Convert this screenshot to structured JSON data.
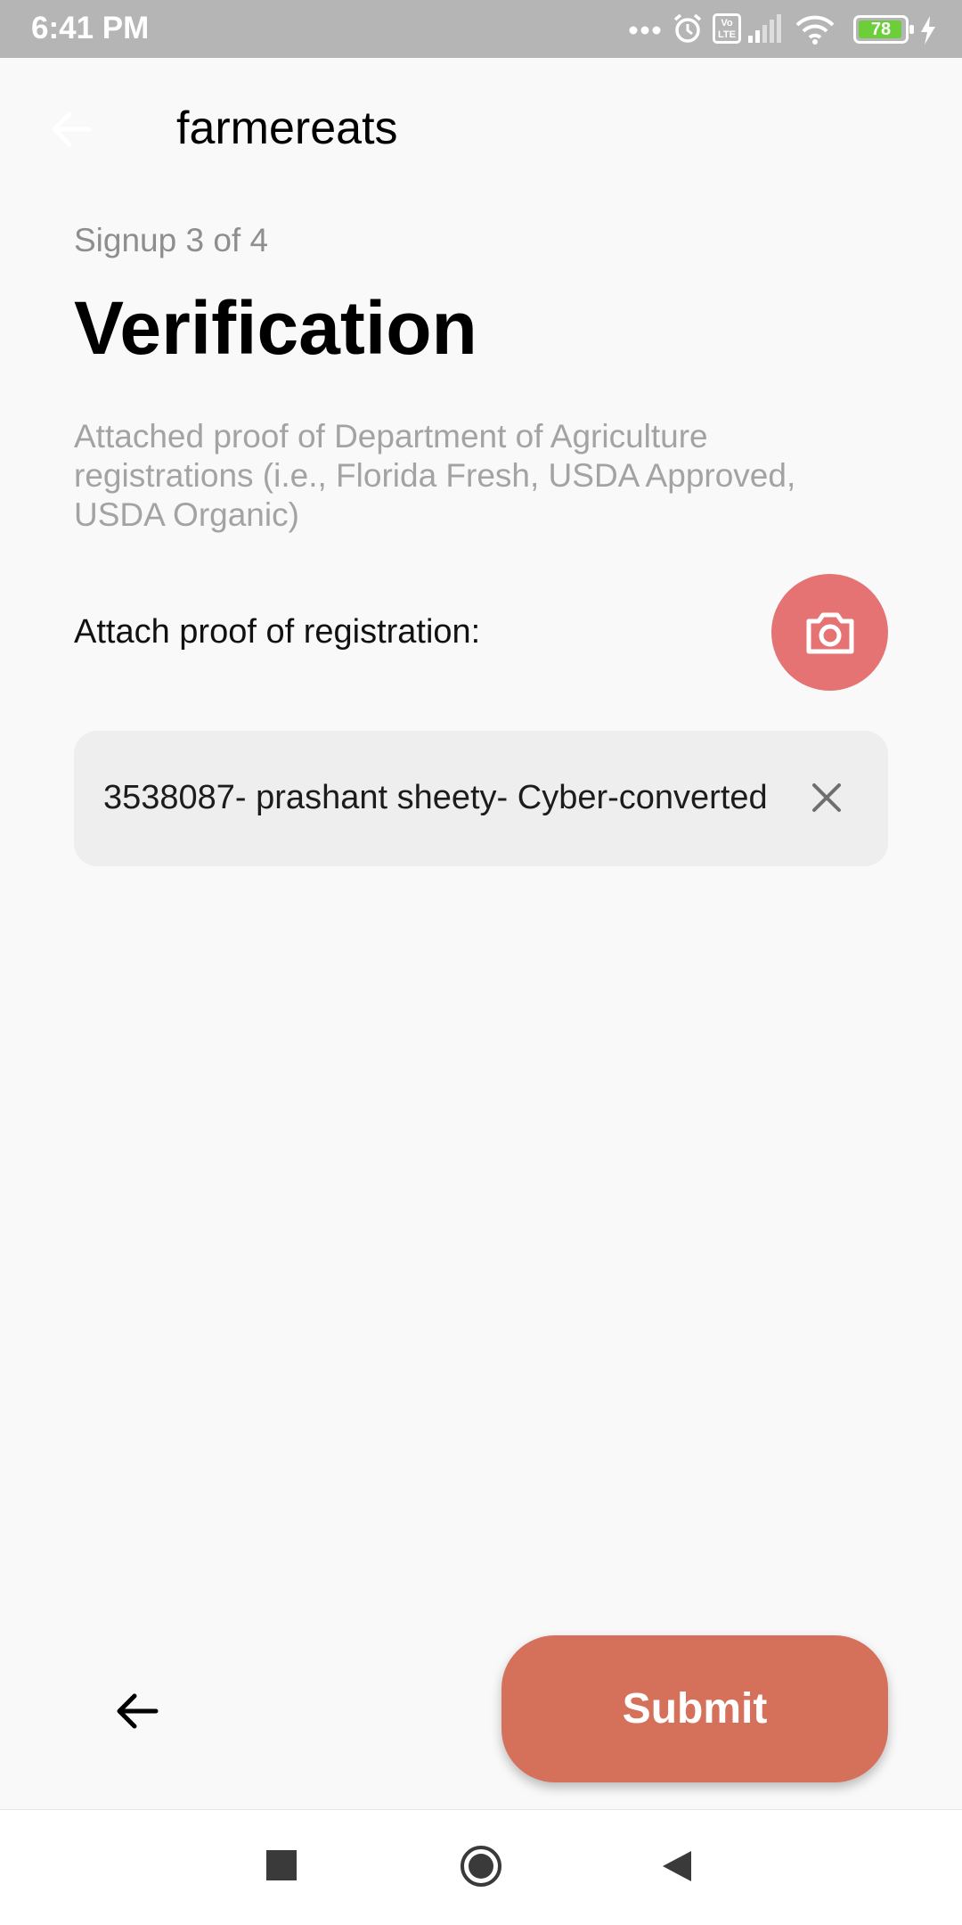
{
  "status_bar": {
    "time": "6:41 PM",
    "battery_level": "78",
    "icons": [
      "more-dots-icon",
      "alarm-icon",
      "volte-icon",
      "signal-icon",
      "wifi-icon",
      "battery-icon",
      "charging-icon"
    ],
    "volte_text": "Vo LTE"
  },
  "header": {
    "app_name": "farmereats",
    "back_icon": "arrow-left-icon"
  },
  "main": {
    "step": "Signup 3 of 4",
    "title": "Verification",
    "description": "Attached proof of Department of Agriculture registrations (i.e., Florida Fresh, USDA Approved, USDA Organic)",
    "attach_label": "Attach proof of registration:",
    "camera_icon": "camera-icon",
    "attached_file": "3538087- prashant sheety- Cyber-converted",
    "remove_icon": "close-icon"
  },
  "footer": {
    "back_icon": "arrow-left-icon",
    "submit_label": "Submit"
  },
  "nav_bar": {
    "icons": [
      "recent-apps-icon",
      "home-icon",
      "back-triangle-icon"
    ]
  },
  "colors": {
    "accent": "#d5705b",
    "camera_button": "#e57373",
    "status_bar": "#b5b5b5",
    "battery_fill": "#6ccf3a"
  }
}
